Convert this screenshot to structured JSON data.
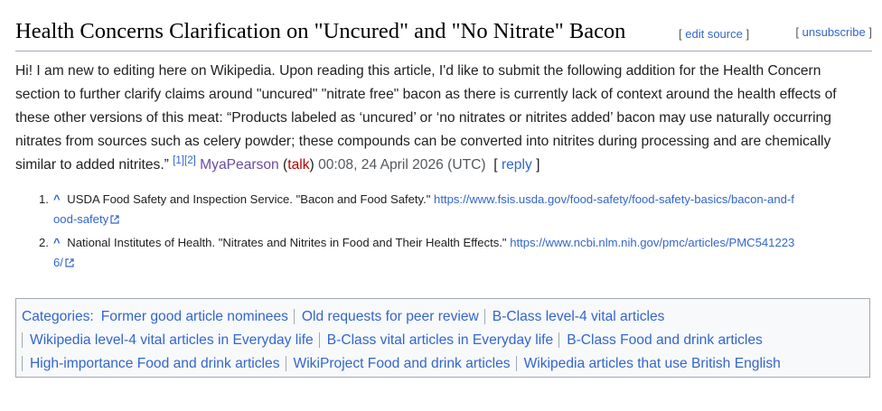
{
  "heading": {
    "title": "Health Concerns Clarification on \"Uncured\" and \"No Nitrate\" Bacon",
    "edit_source_open": "[",
    "edit_source_label": "edit source",
    "edit_source_close": "]",
    "unsubscribe_open": "[",
    "unsubscribe_label": "unsubscribe",
    "unsubscribe_close": "]"
  },
  "comment": {
    "body": "Hi! I am new to editing here on Wikipedia. Upon reading this article, I'd like to submit the following addition for the Health Concern section to further clarify claims around \"uncured\" \"nitrate free\" bacon as there is currently lack of context around the health effects of these other versions of this meat: “Products labeled as ‘uncured’ or ‘no nitrates or nitrites added’ bacon may use naturally occurring nitrates from sources such as celery powder; these compounds can be converted into nitrites during processing and are chemically similar to added nitrites.”",
    "cite1": "[1]",
    "cite2": "[2]",
    "user": "MyaPearson",
    "talk_open": "(",
    "talk": "talk",
    "talk_close": ")",
    "timestamp": "00:08, 24 April 2026 (UTC)",
    "reply_open": "[",
    "reply": "reply",
    "reply_close": "]"
  },
  "references": [
    {
      "number": "1.",
      "caret": "^",
      "text": "USDA Food Safety and Inspection Service. \"Bacon and Food Safety.\"",
      "url_line1": "https://www.fsis.usda.gov/food-safety/food-safety-basics/bacon-and-f",
      "url_line2": "ood-safety"
    },
    {
      "number": "2.",
      "caret": "^",
      "text": "National Institutes of Health. \"Nitrates and Nitrites in Food and Their Health Effects.\"",
      "url_line1": "https://www.ncbi.nlm.nih.gov/pmc/articles/PMC541223",
      "url_line2": "6/"
    }
  ],
  "categories": {
    "label": "Categories",
    "colon": ":",
    "items": [
      "Former good article nominees",
      "Old requests for peer review",
      "B-Class level-4 vital articles",
      "Wikipedia level-4 vital articles in Everyday life",
      "B-Class vital articles in Everyday life",
      "B-Class Food and drink articles",
      "High-importance Food and drink articles",
      "WikiProject Food and drink articles",
      "Wikipedia articles that use British English"
    ]
  },
  "colors": {
    "link": "#3366cc",
    "visited_link": "#6b4ba1",
    "red_link": "#ba0000",
    "text": "#202122",
    "border": "#a2a9b1",
    "catlinks_bg": "#f8f9fa"
  }
}
